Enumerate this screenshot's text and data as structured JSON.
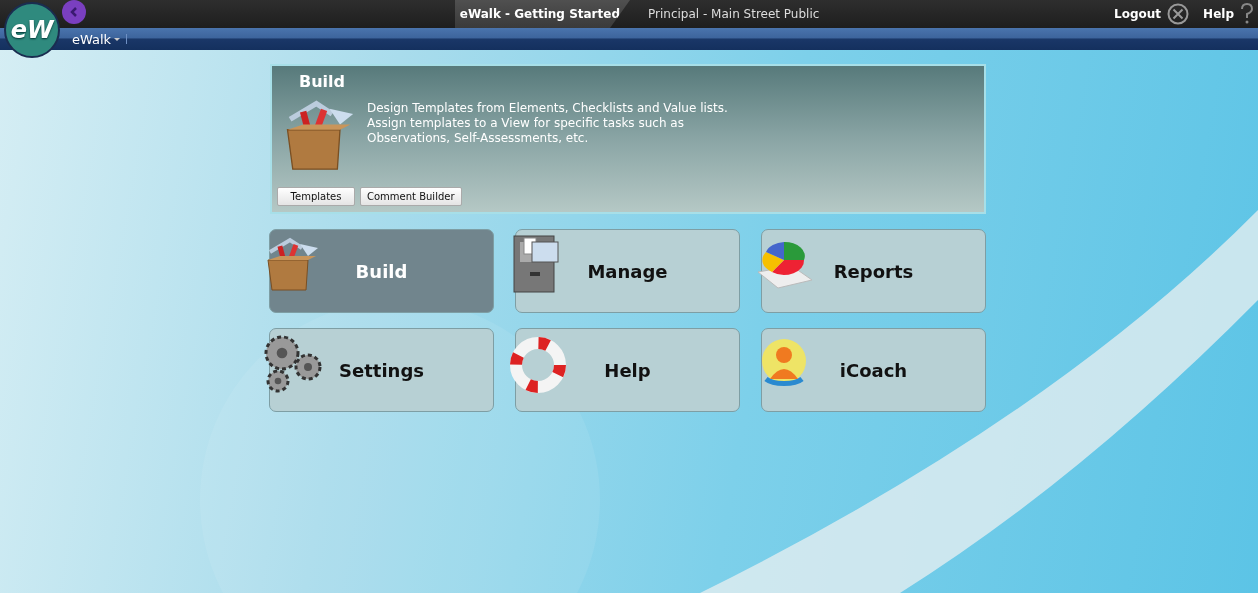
{
  "header": {
    "logo_text": "eW",
    "app_title": "eWalk - Getting Started",
    "context": "Principal - Main Street Public",
    "logout": "Logout",
    "help": "Help"
  },
  "nav": {
    "menu": "eWalk"
  },
  "detail": {
    "title": "Build",
    "kind": "toolbox",
    "description_lines": [
      "Design Templates from Elements, Checklists and Value lists.",
      "Assign templates to a View for specific tasks such as",
      "Observations, Self-Assessments, etc."
    ],
    "buttons": [
      "Templates",
      "Comment Builder"
    ]
  },
  "tiles": [
    {
      "label": "Build",
      "kind": "toolbox",
      "selected": true
    },
    {
      "label": "Manage",
      "kind": "cabinet",
      "selected": false
    },
    {
      "label": "Reports",
      "kind": "chart",
      "selected": false
    },
    {
      "label": "Settings",
      "kind": "gears",
      "selected": false
    },
    {
      "label": "Help",
      "kind": "lifebuoy",
      "selected": false
    },
    {
      "label": "iCoach",
      "kind": "person",
      "selected": false
    }
  ]
}
